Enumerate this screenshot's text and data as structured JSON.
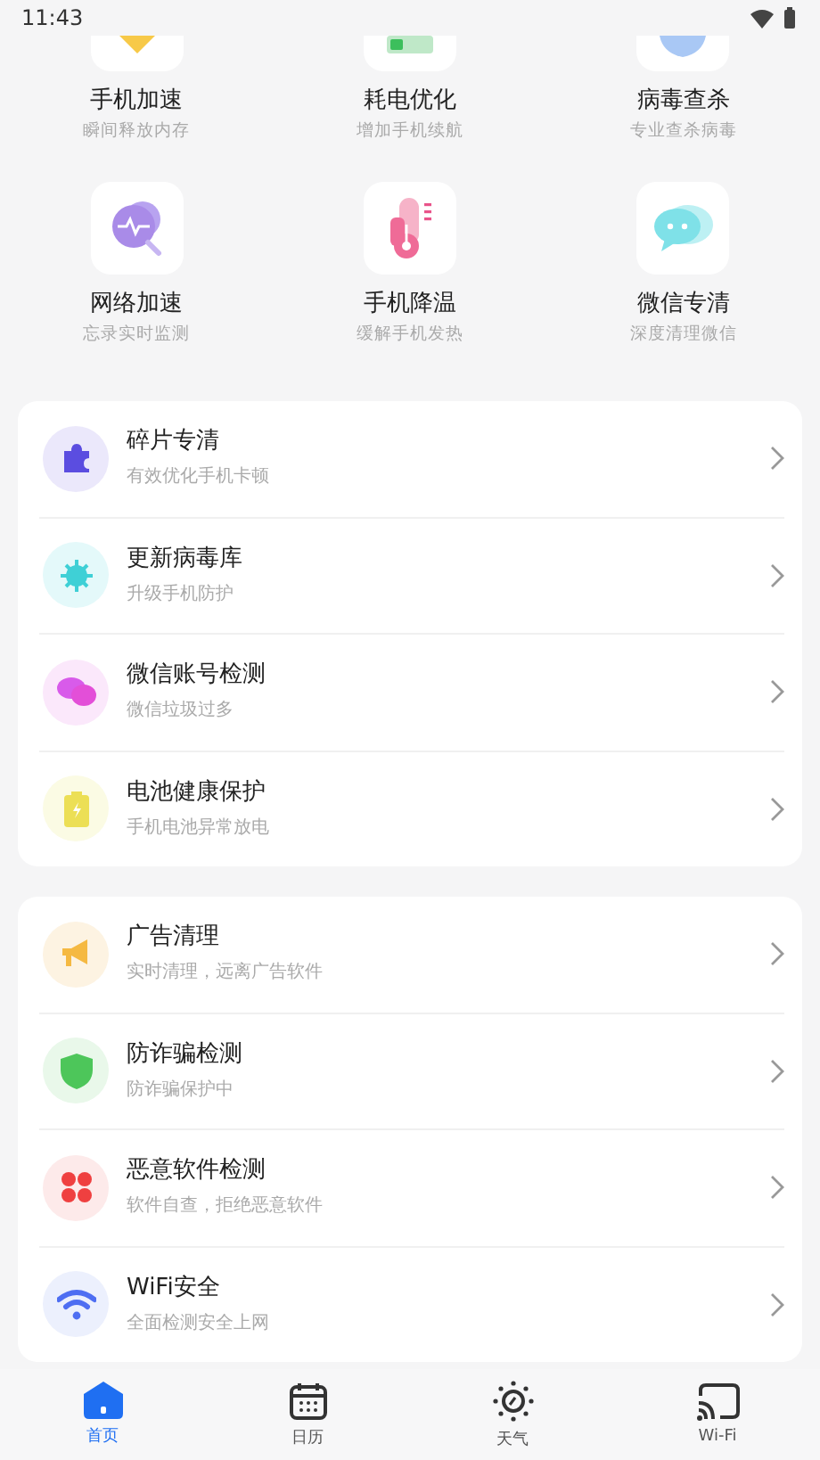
{
  "status_bar": {
    "time": "11:43"
  },
  "tools": [
    {
      "title": "手机加速",
      "subtitle": "瞬间释放内存"
    },
    {
      "title": "耗电优化",
      "subtitle": "增加手机续航"
    },
    {
      "title": "病毒查杀",
      "subtitle": "专业查杀病毒"
    },
    {
      "title": "网络加速",
      "subtitle": "忘录实时监测"
    },
    {
      "title": "手机降温",
      "subtitle": "缓解手机发热"
    },
    {
      "title": "微信专清",
      "subtitle": "深度清理微信"
    }
  ],
  "sections": [
    {
      "items": [
        {
          "title": "碎片专清",
          "subtitle": "有效优化手机卡顿"
        },
        {
          "title": "更新病毒库",
          "subtitle": "升级手机防护"
        },
        {
          "title": "微信账号检测",
          "subtitle": "微信垃圾过多"
        },
        {
          "title": "电池健康保护",
          "subtitle": "手机电池异常放电"
        }
      ]
    },
    {
      "items": [
        {
          "title": "广告清理",
          "subtitle": "实时清理，远离广告软件"
        },
        {
          "title": "防诈骗检测",
          "subtitle": "防诈骗保护中"
        },
        {
          "title": "恶意软件检测",
          "subtitle": "软件自查，拒绝恶意软件"
        },
        {
          "title": "WiFi安全",
          "subtitle": "全面检测安全上网"
        }
      ]
    }
  ],
  "bottom_nav": [
    {
      "label": "首页",
      "selected": true
    },
    {
      "label": "日历",
      "selected": false
    },
    {
      "label": "天气",
      "selected": false
    },
    {
      "label": "Wi-Fi",
      "selected": false
    }
  ]
}
